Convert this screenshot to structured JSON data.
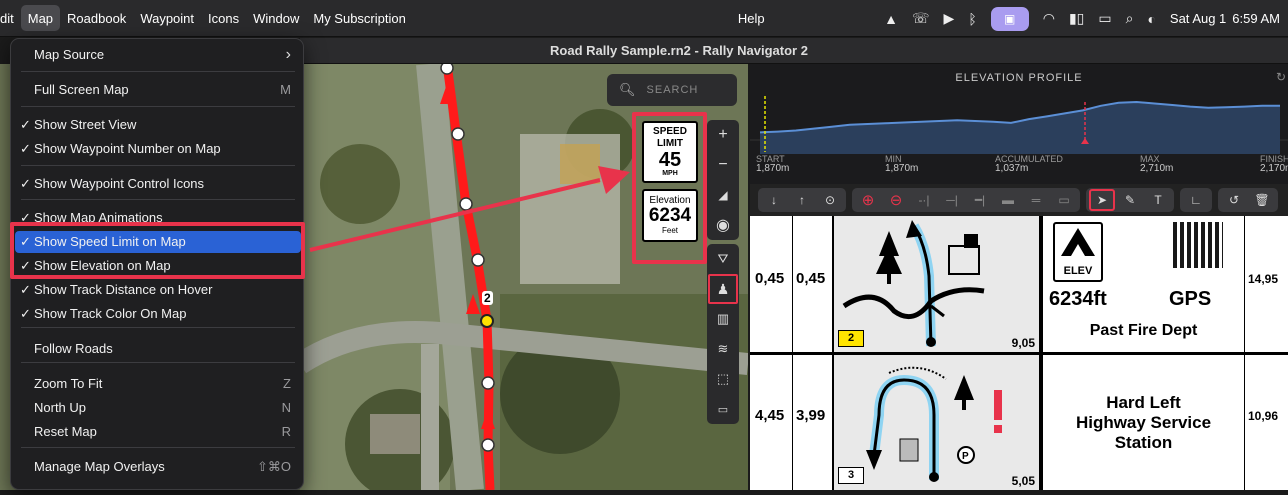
{
  "menubar": {
    "items": [
      "dit",
      "Map",
      "Roadbook",
      "Waypoint",
      "Icons",
      "Window",
      "My Subscription",
      "Help"
    ],
    "date": "Sat Aug 1",
    "time": "6:59 AM"
  },
  "window_title": "Road Rally Sample.rn2 - Rally Navigator 2",
  "map_menu": {
    "items": [
      {
        "label": "Map Source",
        "check": "",
        "shortcut": "",
        "submenu": true
      },
      {
        "label": "Full Screen Map",
        "check": "",
        "shortcut": "M"
      },
      {
        "label": "Show Street View",
        "check": "✓",
        "shortcut": ""
      },
      {
        "label": "Show Waypoint Number on Map",
        "check": "✓",
        "shortcut": ""
      },
      {
        "label": "Show Waypoint Control Icons",
        "check": "✓",
        "shortcut": ""
      },
      {
        "label": "Show Map Animations",
        "check": "✓",
        "shortcut": ""
      },
      {
        "label": "Show Speed Limit on Map",
        "check": "✓",
        "shortcut": "",
        "selected": true
      },
      {
        "label": "Show Elevation on Map",
        "check": "✓",
        "shortcut": ""
      },
      {
        "label": "Show Track Distance on Hover",
        "check": "✓",
        "shortcut": ""
      },
      {
        "label": "Show Track Color On Map",
        "check": "✓",
        "shortcut": ""
      },
      {
        "label": "Follow Roads",
        "check": "",
        "shortcut": ""
      },
      {
        "label": "Zoom To Fit",
        "check": "",
        "shortcut": "Z"
      },
      {
        "label": "North Up",
        "check": "",
        "shortcut": "N"
      },
      {
        "label": "Reset Map",
        "check": "",
        "shortcut": "R"
      },
      {
        "label": "Manage Map Overlays",
        "check": "",
        "shortcut": "⇧⌘O"
      }
    ]
  },
  "map": {
    "search_placeholder": "SEARCH",
    "waypoint_number": "2",
    "speed_sign": {
      "title": "SPEED LIMIT",
      "value": "45",
      "unit": "MPH"
    },
    "elev_sign": {
      "title": "Elevation",
      "value": "6234",
      "unit": "Feet"
    }
  },
  "elevation": {
    "title": "ELEVATION PROFILE",
    "stats": [
      {
        "label": "START",
        "value": "1,870m"
      },
      {
        "label": "MIN",
        "value": "1,870m"
      },
      {
        "label": "ACCUMULATED",
        "value": "1,037m"
      },
      {
        "label": "MAX",
        "value": "2,710m"
      },
      {
        "label": "FINISH",
        "value": "2,170m"
      }
    ],
    "profile": [
      0.2,
      0.22,
      0.25,
      0.3,
      0.35,
      0.4,
      0.42,
      0.44,
      0.46,
      0.48,
      0.5,
      0.52,
      0.5,
      0.48,
      0.45,
      0.55,
      0.62,
      0.7,
      0.78,
      0.9,
      0.98,
      1.0,
      0.96,
      0.92,
      0.88,
      0.85,
      0.86,
      0.88,
      0.9,
      0.9
    ]
  },
  "roadbook": {
    "row1": {
      "total": "0,45",
      "partial": "0,45",
      "wp": "2",
      "dist": "9,05",
      "info_sign": "ELEV",
      "elev_text": "6234ft",
      "gps": "GPS",
      "note": "Past Fire Dept",
      "right": "14,95"
    },
    "row2": {
      "total": "4,45",
      "partial": "3,99",
      "wp": "3",
      "dist": "5,05",
      "note_line1": "Hard Left",
      "note_line2": "Highway Service",
      "note_line3": "Station",
      "right": "10,96"
    }
  },
  "colors": {
    "highlight": "#e8334b",
    "route": "#ff1a1a",
    "selected": "#2a62d5",
    "stage": "#a99cf0"
  }
}
